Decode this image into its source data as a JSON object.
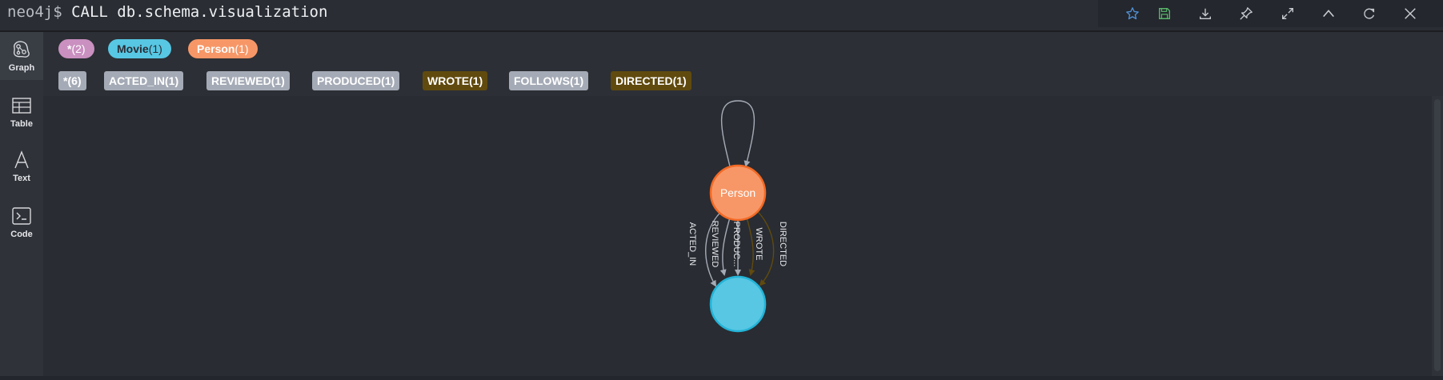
{
  "header": {
    "prompt": "neo4j$",
    "command": "CALL db.schema.visualization"
  },
  "toolbar": {
    "icons": [
      "star-icon",
      "save-icon",
      "download-icon",
      "pin-icon",
      "expand-icon",
      "collapse-icon",
      "refresh-icon",
      "close-icon"
    ]
  },
  "sidebar": {
    "items": [
      {
        "label": "Graph",
        "icon": "graph-icon",
        "active": true
      },
      {
        "label": "Table",
        "icon": "table-icon",
        "active": false
      },
      {
        "label": "Text",
        "icon": "text-icon",
        "active": false
      },
      {
        "label": "Code",
        "icon": "code-icon",
        "active": false
      }
    ]
  },
  "legend": {
    "node_labels": [
      {
        "name": "*",
        "count": "(2)",
        "color": "#c990c0",
        "text_color": "#ffffff"
      },
      {
        "name": "Movie",
        "count": "(1)",
        "color": "#57c7e3",
        "text_color": "#2a2c34"
      },
      {
        "name": "Person",
        "count": "(1)",
        "color": "#f79767",
        "text_color": "#ffffff"
      }
    ],
    "relationship_types": [
      {
        "name": "*",
        "count": "(6)",
        "color": "#a5abb6",
        "text_color": "#ffffff"
      },
      {
        "name": "ACTED_IN",
        "count": "(1)",
        "color": "#a5abb6",
        "text_color": "#ffffff"
      },
      {
        "name": "REVIEWED",
        "count": "(1)",
        "color": "#a5abb6",
        "text_color": "#ffffff"
      },
      {
        "name": "PRODUCED",
        "count": "(1)",
        "color": "#a5abb6",
        "text_color": "#ffffff"
      },
      {
        "name": "WROTE",
        "count": "(1)",
        "color": "#604a0e",
        "text_color": "#ffffff"
      },
      {
        "name": "FOLLOWS",
        "count": "(1)",
        "color": "#a5abb6",
        "text_color": "#ffffff"
      },
      {
        "name": "DIRECTED",
        "count": "(1)",
        "color": "#604a0e",
        "text_color": "#ffffff"
      }
    ]
  },
  "graph": {
    "nodes": [
      {
        "label": "Person",
        "color": "#f79767",
        "border": "#f36924"
      },
      {
        "label": "",
        "color": "#57c7e3",
        "border": "#23b3d7"
      }
    ],
    "edge_labels": {
      "acted_in": "ACTED_IN",
      "reviewed": "REVIEWED",
      "produced": "PRODUC...",
      "wrote": "WROTE",
      "directed": "DIRECTED"
    },
    "colors": {
      "gray_edge": "#a5abb6",
      "gold_edge": "#604a0e"
    }
  }
}
